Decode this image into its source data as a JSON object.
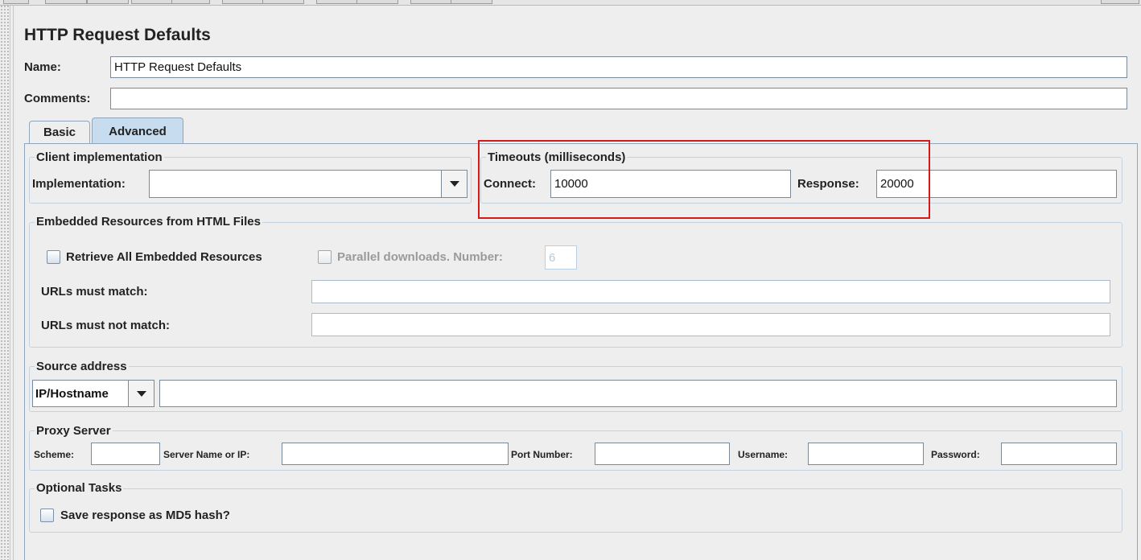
{
  "panel": {
    "title": "HTTP Request Defaults"
  },
  "name_field": {
    "label": "Name:",
    "value": "HTTP Request Defaults"
  },
  "comments_field": {
    "label": "Comments:",
    "value": ""
  },
  "tabs": [
    {
      "label": "Basic",
      "active": false
    },
    {
      "label": "Advanced",
      "active": true
    }
  ],
  "client_implementation": {
    "legend": "Client implementation",
    "label": "Implementation:",
    "value": ""
  },
  "timeouts": {
    "legend": "Timeouts (milliseconds)",
    "connect_label": "Connect:",
    "connect_value": "10000",
    "response_label": "Response:",
    "response_value": "20000",
    "highlight_color": "#d21a1a"
  },
  "embedded": {
    "legend": "Embedded Resources from HTML Files",
    "retrieve_label": "Retrieve All Embedded Resources",
    "parallel_label": "Parallel downloads. Number:",
    "parallel_value": "6",
    "urls_match_label": "URLs must match:",
    "urls_match_value": "",
    "urls_not_match_label": "URLs must not match:",
    "urls_not_match_value": ""
  },
  "source_address": {
    "legend": "Source address",
    "type_value": "IP/Hostname",
    "value": ""
  },
  "proxy": {
    "legend": "Proxy Server",
    "scheme_label": "Scheme:",
    "server_label": "Server Name or IP:",
    "port_label": "Port Number:",
    "username_label": "Username:",
    "password_label": "Password:"
  },
  "optional_tasks": {
    "legend": "Optional Tasks",
    "md5_label": "Save response as MD5 hash?"
  },
  "icons": {
    "dropdown": "chevron-down-icon"
  }
}
